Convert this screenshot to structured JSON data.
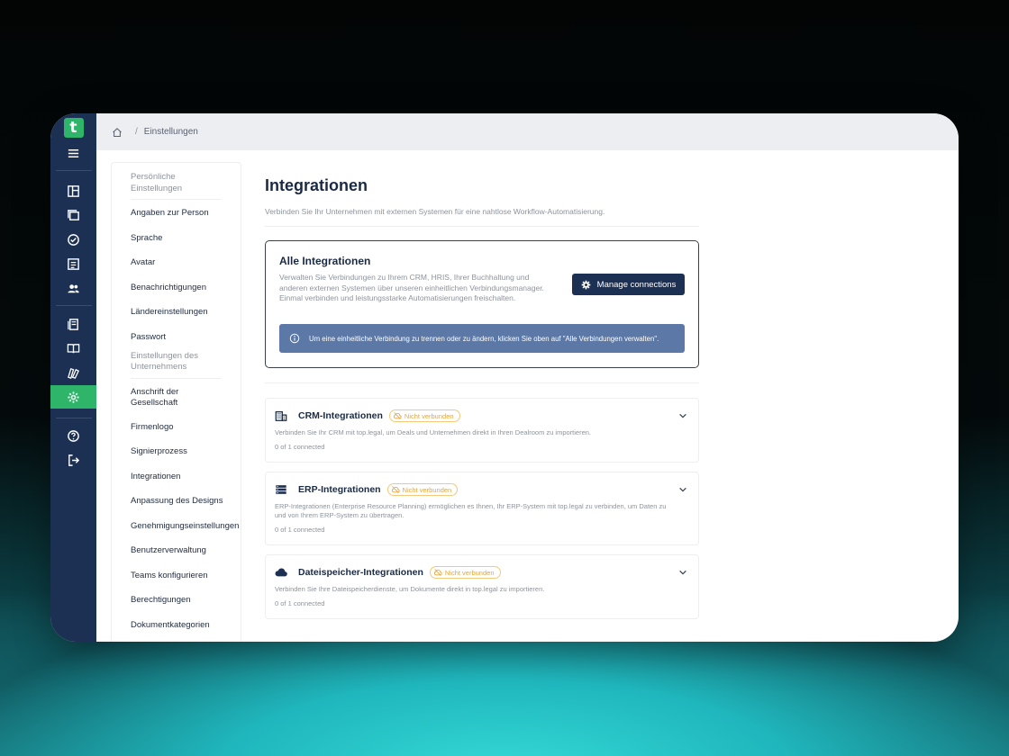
{
  "brand": {
    "logo_letter": "t",
    "accent": "#2fb56a",
    "rail_color": "#1c3054"
  },
  "rail": {
    "top_icons": [
      "menu-icon"
    ],
    "group1": [
      "dashboard-icon",
      "documents-icon",
      "tasks-check-icon",
      "list-icon",
      "users-icon"
    ],
    "group2": [
      "templates-icon",
      "book-icon",
      "clauses-icon",
      "settings-gear-icon"
    ],
    "group3": [
      "help-icon",
      "logout-icon"
    ],
    "active": "settings-gear-icon"
  },
  "breadcrumb": {
    "current": "Einstellungen"
  },
  "subnav": {
    "personal_group": "Persönliche Einstellungen",
    "personal_items": [
      "Angaben zur Person",
      "Sprache",
      "Avatar",
      "Benachrichtigungen",
      "Ländereinstellungen",
      "Passwort"
    ],
    "company_group": "Einstellungen des Unternehmens",
    "company_items": [
      "Anschrift der Gesellschaft",
      "Firmenlogo",
      "Signierprozess",
      "Integrationen",
      "Anpassung des Designs",
      "Genehmigungseinstellungen",
      "Benutzerverwaltung",
      "Teams konfigurieren",
      "Berechtigungen",
      "Dokumentkategorien"
    ]
  },
  "main": {
    "title": "Integrationen",
    "subtitle": "Verbinden Sie Ihr Unternehmen mit externen Systemen für eine nahtlose Workflow-Automatisierung.",
    "all": {
      "title": "Alle Integrationen",
      "description": "Verwalten Sie Verbindungen zu Ihrem CRM, HRIS, Ihrer Buchhaltung und anderen externen Systemen über unseren einheitlichen Verbindungsmanager. Einmal verbinden und leistungsstarke Automatisierungen freischalten.",
      "button": "Manage connections",
      "info": "Um eine einheitliche Verbindung zu trennen oder zu ändern, klicken Sie oben auf \"Alle Verbindungen verwalten\"."
    },
    "cards": [
      {
        "title": "CRM-Integrationen",
        "badge": "Nicht verbunden",
        "description": "Verbinden Sie Ihr CRM mit top.legal, um Deals und Unternehmen direkt in Ihren Dealroom zu importieren.",
        "count": "0 of 1 connected",
        "icon": "building-icon"
      },
      {
        "title": "ERP-Integrationen",
        "badge": "Nicht verbunden",
        "description": "ERP-Integrationen (Enterprise Resource Planning) ermöglichen es Ihnen, Ihr ERP-System mit top.legal zu verbinden, um Daten zu und von Ihrem ERP-System zu übertragen.",
        "count": "0 of 1 connected",
        "icon": "server-icon"
      },
      {
        "title": "Dateispeicher-Integrationen",
        "badge": "Nicht verbunden",
        "description": "Verbinden Sie Ihre Dateispeicherdienste, um Dokumente direkt in top.legal zu importieren.",
        "count": "0 of 1 connected",
        "icon": "cloud-icon"
      }
    ]
  }
}
